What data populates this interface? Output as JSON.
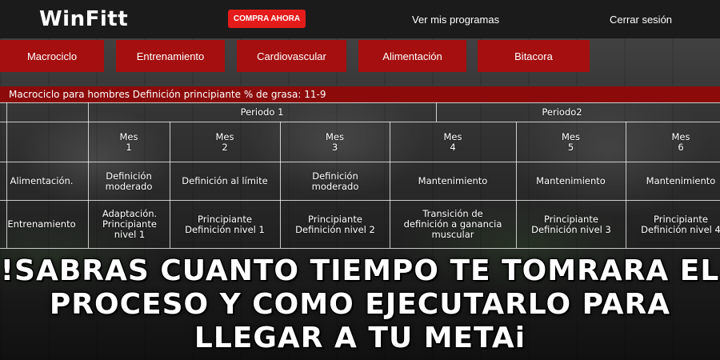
{
  "header": {
    "brand": "WinFitt",
    "buy_label": "COMPRA AHORA",
    "programs_label": "Ver mis programas",
    "logout_label": "Cerrar sesión"
  },
  "tabs": [
    {
      "label": "Macrociclo"
    },
    {
      "label": "Entrenamiento"
    },
    {
      "label": "Cardiovascular"
    },
    {
      "label": "Alimentación"
    },
    {
      "label": "Bitacora"
    }
  ],
  "plan": {
    "title": "Macrociclo para hombres Definición principiante % de grasa: 11-9",
    "periods": [
      "Periodo 1",
      "Periodo2"
    ],
    "months": [
      "Mes\n1",
      "Mes\n2",
      "Mes\n3",
      "Mes\n4",
      "Mes\n5",
      "Mes\n6"
    ],
    "rows": [
      {
        "label": "Alimentación.",
        "cells": [
          "Definición moderado",
          "Definición al límite",
          "Definición moderado",
          "Mantenimiento",
          "Mantenimiento",
          "Mantenimiento"
        ]
      },
      {
        "label": "Entrenamiento",
        "cells": [
          "Adaptación. Principiante nivel 1",
          "Principiante Definición nivel 1",
          "Principiante Definición nivel 2",
          "Transición de definición a ganancia muscular",
          "Principiante Definición nivel 3",
          "Principiante Definición nivel 4"
        ]
      }
    ]
  },
  "headline": {
    "line1": "!SABRAS CUANTO TIEMPO TE TOMRARA EL",
    "line2": "PROCESO Y COMO EJECUTARLO PARA",
    "line3": "LLEGAR A TU METAi"
  },
  "colors": {
    "topbar": "#1b1b1b",
    "tab": "#a50f0f",
    "title_strip": "#8c0a0a",
    "buy_button": "#e41b1b"
  }
}
